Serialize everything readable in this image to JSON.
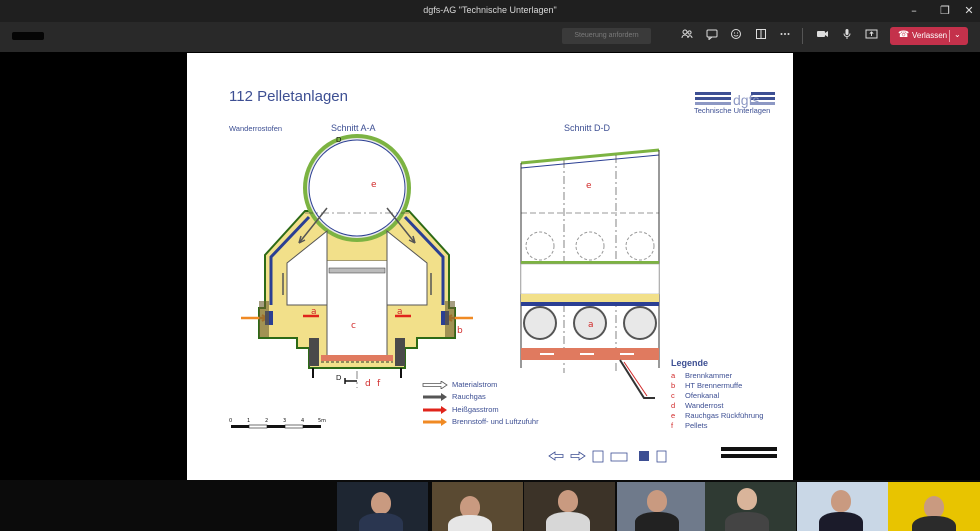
{
  "window": {
    "title": "dgfs-AG \"Technische Unterlagen\"",
    "controls": [
      "–",
      "❐",
      "✕"
    ]
  },
  "toolbar": {
    "control_request_label": "Steuerung anfordern",
    "leave_label": "Verlassen",
    "icons": [
      "participants-icon",
      "chat-icon",
      "reactions-icon",
      "rooms-icon",
      "more-icon",
      "camera-icon",
      "mic-icon",
      "share-icon"
    ]
  },
  "slide": {
    "title": "112 Pelletanlagen",
    "logo_text": "dgfs",
    "logo_subtitle": "Technische Unterlagen",
    "left_caption": "Wanderrostofen",
    "section_aa": "Schnitt A-A",
    "section_dd": "Schnitt D-D",
    "markers": {
      "d_top": "D",
      "d_bottom": "D",
      "a": "a",
      "b": "b",
      "c": "c",
      "d": "d",
      "e": "e",
      "f": "f"
    },
    "scale": {
      "labels": [
        "0",
        "1",
        "2",
        "3",
        "4",
        "5m"
      ]
    },
    "flows": [
      {
        "label": "Materialstrom",
        "color": "#ffffff"
      },
      {
        "label": "Rauchgas",
        "color": "#555555"
      },
      {
        "label": "Heißgasstrom",
        "color": "#e0241b"
      },
      {
        "label": "Brennstoff- und Luftzufuhr",
        "color": "#f08a24"
      }
    ],
    "legend": {
      "title": "Legende",
      "items": [
        {
          "key": "a",
          "text": "Brennkammer"
        },
        {
          "key": "b",
          "text": "HT Brennermuffe"
        },
        {
          "key": "c",
          "text": "Ofenkanal"
        },
        {
          "key": "d",
          "text": "Wanderrost"
        },
        {
          "key": "e",
          "text": "Rauchgas Rückführung"
        },
        {
          "key": "f",
          "text": "Pellets"
        }
      ]
    }
  },
  "colors": {
    "accent_blue": "#3d4f93",
    "leave_red": "#c4314b",
    "marker_red": "#d12a2a",
    "insulation_green": "#7cb342",
    "refractory_yellow": "#f2e08a"
  },
  "participants": [
    {
      "name": "participant-1"
    },
    {
      "name": "participant-2"
    },
    {
      "name": "participant-3"
    },
    {
      "name": "participant-4"
    },
    {
      "name": "participant-5"
    },
    {
      "name": "participant-6"
    },
    {
      "name": "participant-7"
    }
  ]
}
